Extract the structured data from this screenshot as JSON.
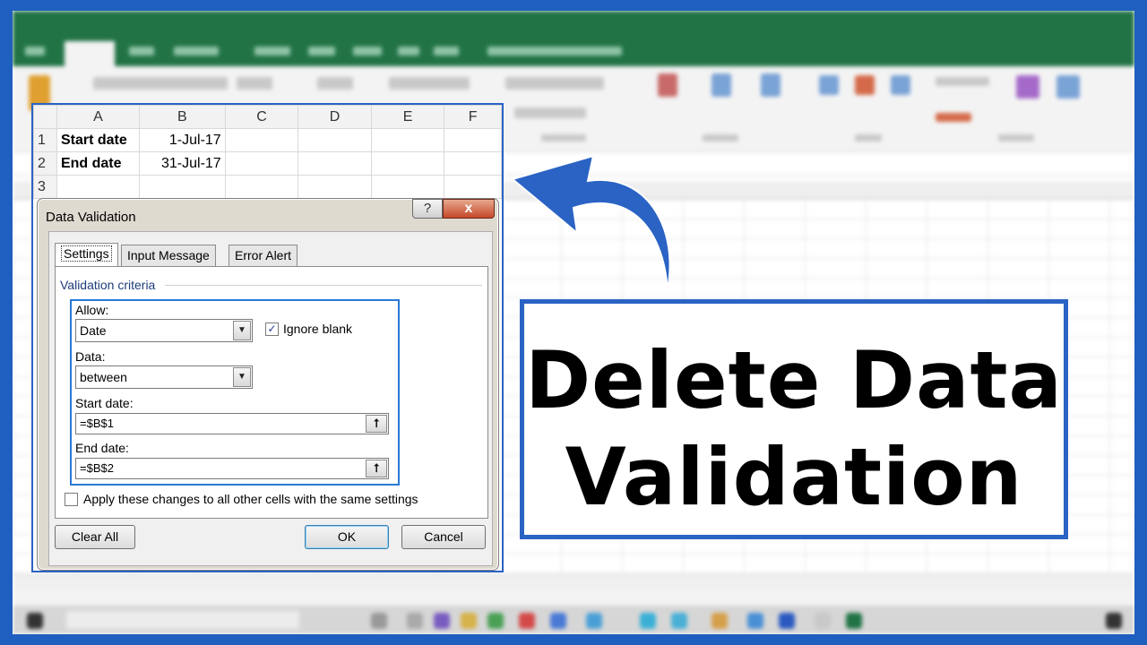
{
  "spreadsheet": {
    "columns": [
      "A",
      "B",
      "C",
      "D",
      "E",
      "F"
    ],
    "rows": [
      {
        "num": "1",
        "cells": [
          "Start date",
          "1-Jul-17",
          "",
          "",
          "",
          ""
        ]
      },
      {
        "num": "2",
        "cells": [
          "End date",
          "31-Jul-17",
          "",
          "",
          "",
          ""
        ]
      },
      {
        "num": "3",
        "cells": [
          "",
          "",
          "",
          "",
          "",
          ""
        ]
      }
    ]
  },
  "dialog": {
    "title": "Data Validation",
    "help_label": "?",
    "close_label": "x",
    "tabs": [
      "Settings",
      "Input Message",
      "Error Alert"
    ],
    "section_label": "Validation criteria",
    "allow_label": "Allow:",
    "allow_value": "Date",
    "ignore_blank_label": "Ignore blank",
    "ignore_blank_checked": true,
    "data_label": "Data:",
    "data_value": "between",
    "start_label": "Start date:",
    "start_value": "=$B$1",
    "end_label": "End date:",
    "end_value": "=$B$2",
    "apply_label": "Apply these changes to all other cells with the same settings",
    "apply_checked": false,
    "clear_all_label": "Clear All",
    "ok_label": "OK",
    "cancel_label": "Cancel"
  },
  "overlay": {
    "title_line1": "Delete Data",
    "title_line2": "Validation"
  },
  "colors": {
    "accent_blue": "#2a63c4",
    "excel_green": "#217346"
  }
}
